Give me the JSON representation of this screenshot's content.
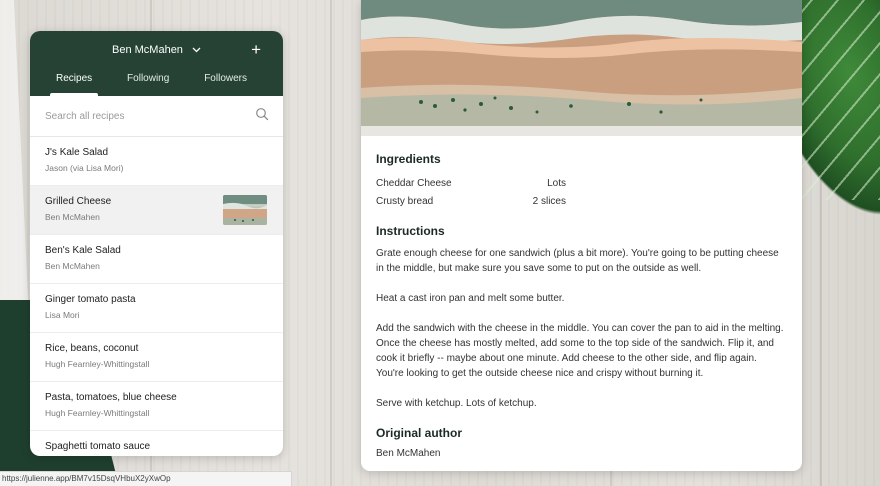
{
  "sidebar": {
    "user_name": "Ben McMahen",
    "add_label": "+",
    "tabs": [
      {
        "label": "Recipes",
        "active": true
      },
      {
        "label": "Following",
        "active": false
      },
      {
        "label": "Followers",
        "active": false
      }
    ],
    "search_placeholder": "Search all recipes",
    "recipes": [
      {
        "title": "J's Kale Salad",
        "author": "Jason (via Lisa Mori)",
        "selected": false,
        "has_thumbnail": false
      },
      {
        "title": "Grilled Cheese",
        "author": "Ben McMahen",
        "selected": true,
        "has_thumbnail": true
      },
      {
        "title": "Ben's Kale Salad",
        "author": "Ben McMahen",
        "selected": false,
        "has_thumbnail": false
      },
      {
        "title": "Ginger tomato pasta",
        "author": "Lisa Mori",
        "selected": false,
        "has_thumbnail": false
      },
      {
        "title": "Rice, beans, coconut",
        "author": "Hugh Fearnley-Whittingstall",
        "selected": false,
        "has_thumbnail": false
      },
      {
        "title": "Pasta, tomatoes, blue cheese",
        "author": "Hugh Fearnley-Whittingstall",
        "selected": false,
        "has_thumbnail": false
      },
      {
        "title": "Spaghetti tomato sauce",
        "author": "",
        "selected": false,
        "has_thumbnail": false
      }
    ]
  },
  "status_bar": {
    "url": "https://julienne.app/BM7v15DsqVHbuX2yXwOp"
  },
  "recipe": {
    "ingredients_heading": "Ingredients",
    "ingredients": [
      {
        "name": "Cheddar Cheese",
        "quantity": "Lots"
      },
      {
        "name": "Crusty bread",
        "quantity": "2 slices"
      }
    ],
    "instructions_heading": "Instructions",
    "instructions": [
      "Grate enough cheese for one sandwich (plus a bit more). You're going to be putting cheese in the middle, but make sure you save some to put on the outside as well.",
      "Heat a cast iron pan and melt some butter.",
      "Add the sandwich with the cheese in the middle. You can cover the pan to aid in the melting. Once the cheese has mostly melted, add some to the top side of the sandwich. Flip it, and cook it briefly -- maybe about one minute. Add cheese to the other side, and flip again. You're looking to get the outside cheese nice and crispy without burning it.",
      "Serve with ketchup. Lots of ketchup."
    ],
    "author_heading": "Original author",
    "author": "Ben McMahen"
  },
  "colors": {
    "header_green": "#254234",
    "selected_row": "#f1f1f1"
  },
  "icons": {
    "search": "search-icon",
    "user_menu": "chevron-down-icon",
    "add": "plus-icon"
  }
}
